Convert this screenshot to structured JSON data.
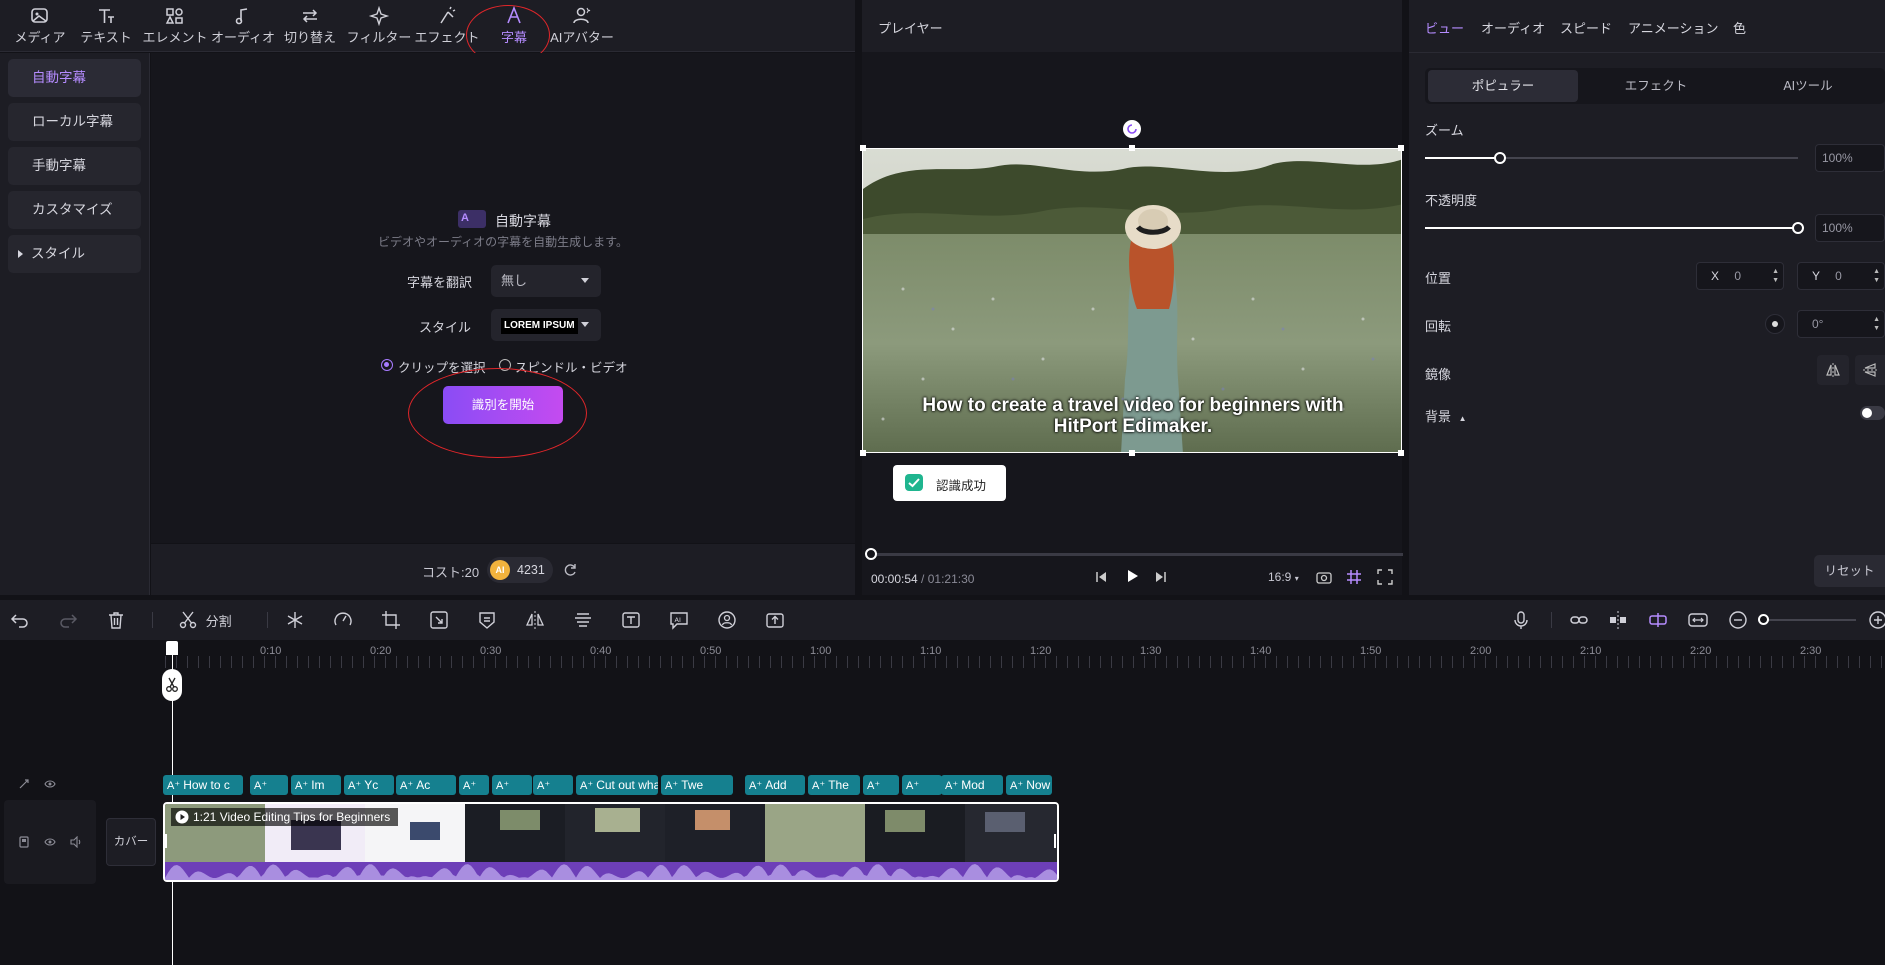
{
  "toolbar": {
    "items": [
      {
        "label": "メディア",
        "icon": "media-icon"
      },
      {
        "label": "テキスト",
        "icon": "text-icon"
      },
      {
        "label": "エレメント",
        "icon": "element-icon"
      },
      {
        "label": "オーディオ",
        "icon": "audio-icon"
      },
      {
        "label": "切り替え",
        "icon": "transition-icon"
      },
      {
        "label": "フィルター",
        "icon": "filter-icon"
      },
      {
        "label": "エフェクト",
        "icon": "effect-icon"
      },
      {
        "label": "字幕",
        "icon": "subtitle-icon"
      },
      {
        "label": "AIアバター",
        "icon": "avatar-icon"
      }
    ],
    "active": "字幕"
  },
  "leftnav": {
    "items": [
      "自動字幕",
      "ローカル字幕",
      "手動字幕",
      "カスタマイズ",
      "スタイル"
    ]
  },
  "auto_subtitle": {
    "title": "自動字幕",
    "description": "ビデオやオーディオの字幕を自動生成します。",
    "translate_label": "字幕を翻訳",
    "translate_value": "無し",
    "style_label": "スタイル",
    "style_value": "LOREM IPSUM",
    "option_clip": "クリップを選択",
    "option_spindle": "スピンドル・ビデオ",
    "start_button": "識別を開始",
    "cost_label": "コスト:20",
    "credits": "4231",
    "ai_badge": "AI"
  },
  "player": {
    "title": "プレイヤー",
    "caption_line1": "How to create a travel video for beginners with",
    "caption_line2": "HitPort Edimaker.",
    "toast": "認識成功",
    "time_current": "00:00:54",
    "time_sep": " / ",
    "time_total": "01:21:30",
    "aspect": "16:9",
    "progress": 0.01
  },
  "inspector": {
    "tabs": [
      "ビュー",
      "オーディオ",
      "スピード",
      "アニメーション",
      "色"
    ],
    "segments": [
      "ポピュラー",
      "エフェクト",
      "AIツール"
    ],
    "zoom_label": "ズーム",
    "zoom_value": "100%",
    "zoom_level": 0.2,
    "opacity_label": "不透明度",
    "opacity_value": "100%",
    "opacity_level": 1.0,
    "position_label": "位置",
    "x_label": "X",
    "x_value": "0",
    "y_label": "Y",
    "y_value": "0",
    "rotation_label": "回転",
    "rotation_value": "0°",
    "mirror_label": "鏡像",
    "background_label": "背景",
    "reset_button": "リセット"
  },
  "timeline": {
    "split_label": "分割",
    "ticks": [
      "0:10",
      "0:20",
      "0:30",
      "0:40",
      "0:50",
      "1:00",
      "1:10",
      "1:20",
      "1:30",
      "1:40",
      "1:50",
      "2:00",
      "2:10",
      "2:20",
      "2:30"
    ],
    "cover_label": "カバー",
    "clip_title": "1:21 Video Editing Tips for Beginners",
    "subtitle_clips": [
      "How to c",
      "",
      "Im",
      "Yc",
      "Ac",
      "",
      "",
      "",
      "Cut out wha",
      "Twe",
      "Add",
      "The",
      "",
      "",
      "Mod",
      "Now enjoy"
    ]
  },
  "colors": {
    "accent": "#b58cff",
    "subtitle_clip": "#15808f",
    "audio_wave": "#7b4fc4",
    "highlight": "#e0262a"
  }
}
